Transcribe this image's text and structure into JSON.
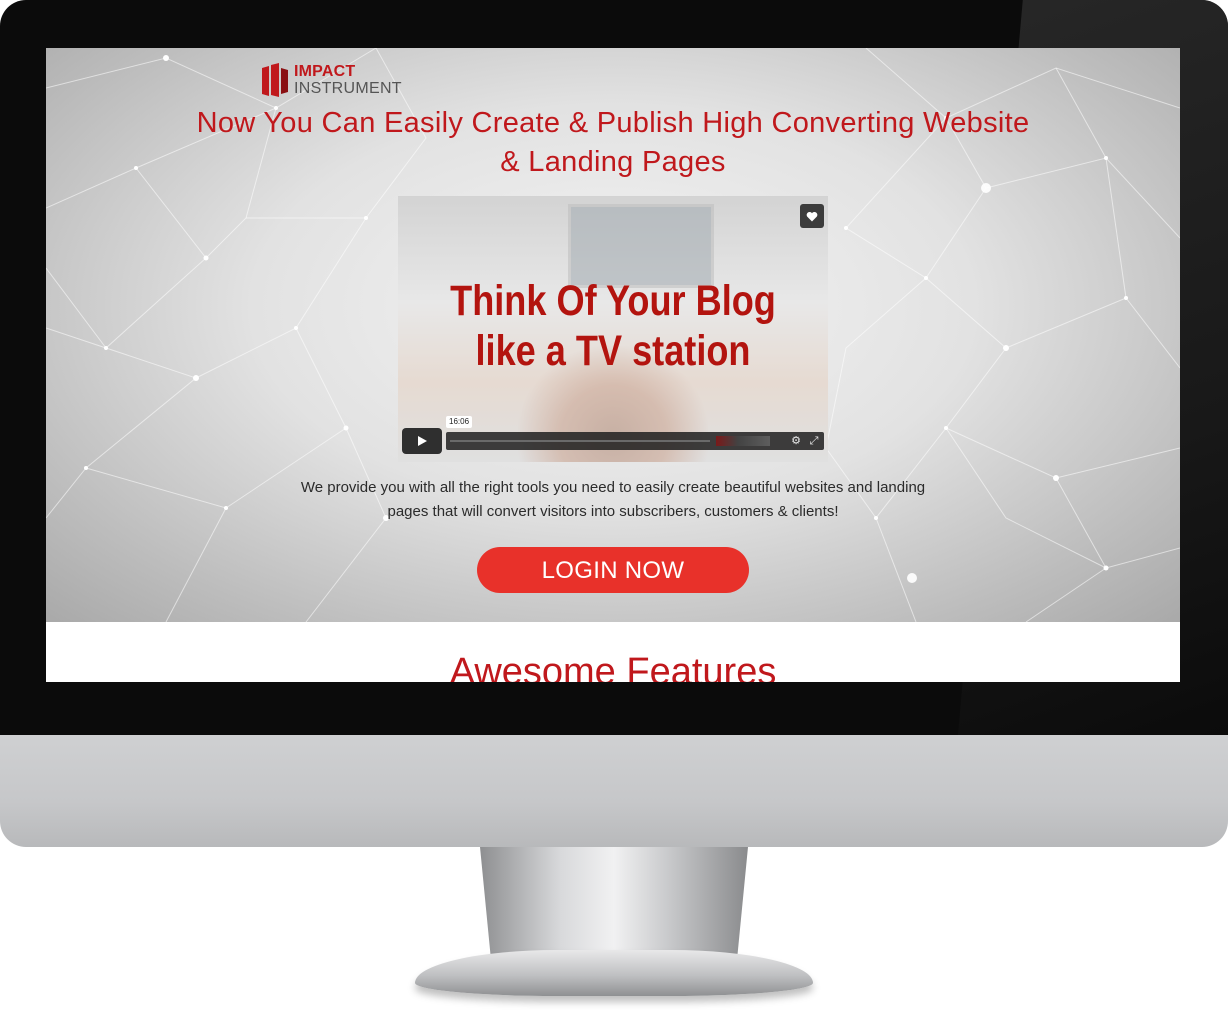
{
  "logo": {
    "line1": "IMPACT",
    "line2": "INSTRUMENT"
  },
  "hero": {
    "headline": "Now You Can Easily Create & Publish High Converting Website & Landing Pages",
    "description": "We provide you with all the right tools you need to easily create beautiful websites and landing pages that will convert visitors into subscribers, customers & clients!",
    "cta_label": "LOGIN NOW"
  },
  "video": {
    "title_line1": "Think Of Your Blog",
    "title_line2": "like a TV station",
    "timestamp": "16:06"
  },
  "features": {
    "title": "Awesome Features"
  },
  "colors": {
    "brand_red": "#c0181c",
    "cta_red": "#e8312a",
    "frame": "#0b0b0b",
    "chin": "#c6c7c9"
  },
  "icons": [
    "logo-mark-icon",
    "heart-icon",
    "play-icon",
    "gear-icon",
    "fullscreen-icon"
  ]
}
